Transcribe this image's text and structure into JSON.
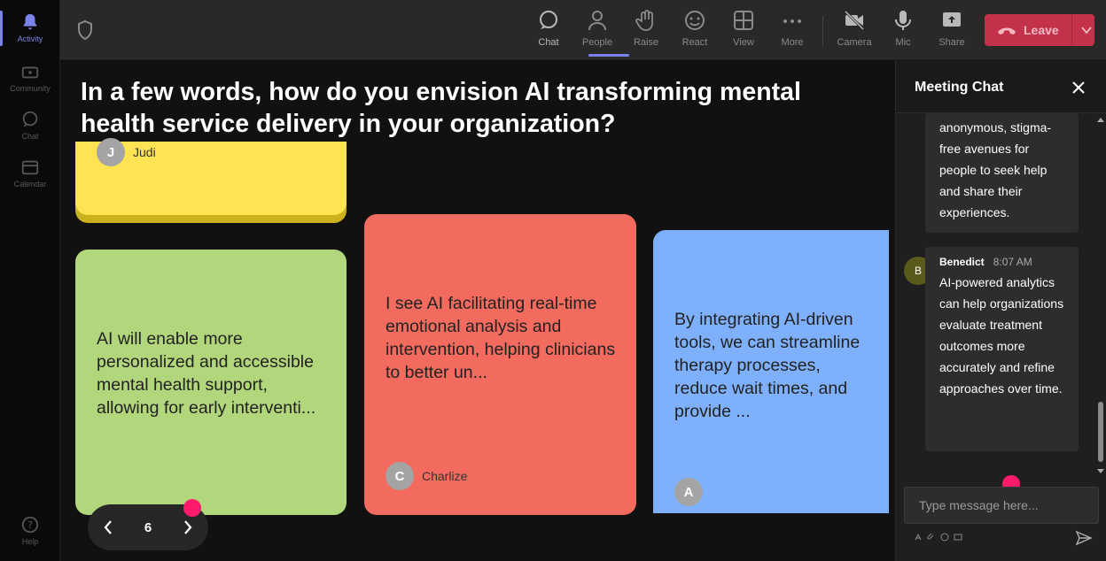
{
  "rail": {
    "items": [
      {
        "label": "Activity",
        "icon": "bell-icon",
        "active": true
      },
      {
        "label": "Community",
        "icon": "community-icon"
      },
      {
        "label": "Chat",
        "icon": "chat-icon"
      },
      {
        "label": "Calendar",
        "icon": "calendar-icon"
      }
    ],
    "help": {
      "label": "Help",
      "icon": "help-icon"
    }
  },
  "toolbar": {
    "buttons": [
      {
        "label": "Chat",
        "icon": "chat-icon",
        "active": true
      },
      {
        "label": "People",
        "icon": "people-icon"
      },
      {
        "label": "Raise",
        "icon": "raise-hand-icon"
      },
      {
        "label": "React",
        "icon": "react-icon"
      },
      {
        "label": "View",
        "icon": "view-icon"
      },
      {
        "label": "More",
        "icon": "more-icon"
      },
      {
        "label": "Camera",
        "icon": "camera-off-icon"
      },
      {
        "label": "Mic",
        "icon": "mic-icon"
      },
      {
        "label": "Share",
        "icon": "share-icon"
      }
    ],
    "leave_label": "Leave",
    "leave_color": "#c4314b"
  },
  "stage": {
    "question": "In a few words, how do you envision AI transforming mental health service delivery in your organization?",
    "notes": [
      {
        "color": "#ffe353",
        "text": "",
        "author": "Judi",
        "initial": "J"
      },
      {
        "color": "#b2d67b",
        "text": "AI will enable more personalized and accessible mental health support, allowing for early interventi...",
        "author": "",
        "initial": ""
      },
      {
        "color": "#f26b5e",
        "text": "I see AI facilitating real-time emotional analysis and intervention, helping clinicians to better un...",
        "author": "Charlize",
        "initial": "C"
      },
      {
        "color": "#7fb0fb",
        "text": "By integrating AI-driven tools, we can streamline therapy processes, reduce wait times, and provide ...",
        "author": "",
        "initial": "A"
      }
    ],
    "pager": {
      "page": "6"
    }
  },
  "chat": {
    "title": "Meeting Chat",
    "messages": [
      {
        "sender": "",
        "time": "",
        "text": "anonymous, stigma-free avenues for people to seek help and share their experiences."
      },
      {
        "sender": "Benedict",
        "initial": "B",
        "time": "8:07 AM",
        "text": "AI-powered analytics can help organizations evaluate treatment outcomes more accurately and refine approaches over time."
      }
    ],
    "input_placeholder": "Type message here..."
  }
}
